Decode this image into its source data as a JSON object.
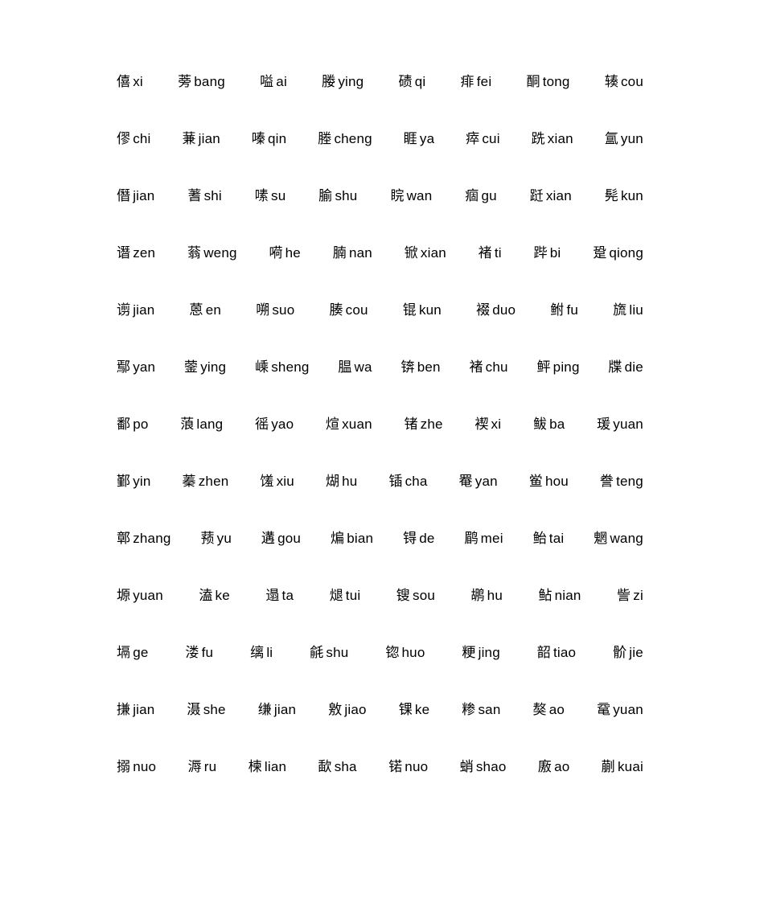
{
  "document": {
    "title": "Chinese Character Pinyin List",
    "text_color": "#000000",
    "background_color": "#ffffff"
  },
  "rows": [
    [
      {
        "hanzi": "僖",
        "pinyin": "xi"
      },
      {
        "hanzi": "蒡",
        "pinyin": "bang"
      },
      {
        "hanzi": "嗌",
        "pinyin": "ai"
      },
      {
        "hanzi": "媵",
        "pinyin": "ying"
      },
      {
        "hanzi": "碛",
        "pinyin": "qi"
      },
      {
        "hanzi": "痱",
        "pinyin": "fei"
      },
      {
        "hanzi": "酮",
        "pinyin": "tong"
      },
      {
        "hanzi": "辏",
        "pinyin": "cou"
      }
    ],
    [
      {
        "hanzi": "僇",
        "pinyin": "chi"
      },
      {
        "hanzi": "蒹",
        "pinyin": "jian"
      },
      {
        "hanzi": "嗪",
        "pinyin": "qin"
      },
      {
        "hanzi": "塍",
        "pinyin": "cheng"
      },
      {
        "hanzi": "睚",
        "pinyin": "ya"
      },
      {
        "hanzi": "瘁",
        "pinyin": "cui"
      },
      {
        "hanzi": "跣",
        "pinyin": "xian"
      },
      {
        "hanzi": "氲",
        "pinyin": "yun"
      }
    ],
    [
      {
        "hanzi": "僭",
        "pinyin": "jian"
      },
      {
        "hanzi": "蓍",
        "pinyin": "shi"
      },
      {
        "hanzi": "嗉",
        "pinyin": "su"
      },
      {
        "hanzi": "腧",
        "pinyin": "shu"
      },
      {
        "hanzi": "睆",
        "pinyin": "wan"
      },
      {
        "hanzi": "痼",
        "pinyin": "gu"
      },
      {
        "hanzi": "跹",
        "pinyin": "xian"
      },
      {
        "hanzi": "髡",
        "pinyin": "kun"
      }
    ],
    [
      {
        "hanzi": "谮",
        "pinyin": "zen"
      },
      {
        "hanzi": "蓊",
        "pinyin": "weng"
      },
      {
        "hanzi": "嗬",
        "pinyin": "he"
      },
      {
        "hanzi": "腩",
        "pinyin": "nan"
      },
      {
        "hanzi": "锨",
        "pinyin": "xian"
      },
      {
        "hanzi": "褚",
        "pinyin": "ti"
      },
      {
        "hanzi": "跸",
        "pinyin": "bi"
      },
      {
        "hanzi": "跫",
        "pinyin": "qiong"
      }
    ],
    [
      {
        "hanzi": "谫",
        "pinyin": "jian"
      },
      {
        "hanzi": "蒽",
        "pinyin": "en"
      },
      {
        "hanzi": "嗍",
        "pinyin": "suo"
      },
      {
        "hanzi": "腠",
        "pinyin": "cou"
      },
      {
        "hanzi": "锟",
        "pinyin": "kun"
      },
      {
        "hanzi": "裰",
        "pinyin": "duo"
      },
      {
        "hanzi": "鲋",
        "pinyin": "fu"
      },
      {
        "hanzi": "旒",
        "pinyin": "liu"
      }
    ],
    [
      {
        "hanzi": "鄢",
        "pinyin": "yan"
      },
      {
        "hanzi": "蓥",
        "pinyin": "ying"
      },
      {
        "hanzi": "嵊",
        "pinyin": "sheng"
      },
      {
        "hanzi": "腽",
        "pinyin": "wa"
      },
      {
        "hanzi": "锛",
        "pinyin": "ben"
      },
      {
        "hanzi": "褚",
        "pinyin": "chu"
      },
      {
        "hanzi": "鲆",
        "pinyin": "ping"
      },
      {
        "hanzi": "牒",
        "pinyin": "die"
      }
    ],
    [
      {
        "hanzi": "鄱",
        "pinyin": "po"
      },
      {
        "hanzi": "蒗",
        "pinyin": "lang"
      },
      {
        "hanzi": "徭",
        "pinyin": "yao"
      },
      {
        "hanzi": "煊",
        "pinyin": "xuan"
      },
      {
        "hanzi": "锗",
        "pinyin": "zhe"
      },
      {
        "hanzi": "褉",
        "pinyin": "xi"
      },
      {
        "hanzi": "鲅",
        "pinyin": "ba"
      },
      {
        "hanzi": "瑗",
        "pinyin": "yuan"
      }
    ],
    [
      {
        "hanzi": "鄞",
        "pinyin": "yin"
      },
      {
        "hanzi": "蓁",
        "pinyin": "zhen"
      },
      {
        "hanzi": "馐",
        "pinyin": "xiu"
      },
      {
        "hanzi": "煳",
        "pinyin": "hu"
      },
      {
        "hanzi": "锸",
        "pinyin": "cha"
      },
      {
        "hanzi": "罨",
        "pinyin": "yan"
      },
      {
        "hanzi": "鲎",
        "pinyin": "hou"
      },
      {
        "hanzi": "誊",
        "pinyin": "teng"
      }
    ],
    [
      {
        "hanzi": "鄣",
        "pinyin": "zhang"
      },
      {
        "hanzi": "蓣",
        "pinyin": "yu"
      },
      {
        "hanzi": "遘",
        "pinyin": "gou"
      },
      {
        "hanzi": "煸",
        "pinyin": "bian"
      },
      {
        "hanzi": "锝",
        "pinyin": "de"
      },
      {
        "hanzi": "鹛",
        "pinyin": "mei"
      },
      {
        "hanzi": "鲐",
        "pinyin": "tai"
      },
      {
        "hanzi": "魍",
        "pinyin": "wang"
      }
    ],
    [
      {
        "hanzi": "塬",
        "pinyin": "yuan"
      },
      {
        "hanzi": "溘",
        "pinyin": "ke"
      },
      {
        "hanzi": "遢",
        "pinyin": "ta"
      },
      {
        "hanzi": "煺",
        "pinyin": "tui"
      },
      {
        "hanzi": "锼",
        "pinyin": "sou"
      },
      {
        "hanzi": "鹕",
        "pinyin": "hu"
      },
      {
        "hanzi": "鲇",
        "pinyin": "nian"
      },
      {
        "hanzi": "訾",
        "pinyin": "zi"
      }
    ],
    [
      {
        "hanzi": "塥",
        "pinyin": "ge"
      },
      {
        "hanzi": "溇",
        "pinyin": "fu"
      },
      {
        "hanzi": "缡",
        "pinyin": "li"
      },
      {
        "hanzi": "毹",
        "pinyin": "shu"
      },
      {
        "hanzi": "锪",
        "pinyin": "huo"
      },
      {
        "hanzi": "粳",
        "pinyin": "jing"
      },
      {
        "hanzi": "韶",
        "pinyin": "tiao"
      },
      {
        "hanzi": "骱",
        "pinyin": "jie"
      }
    ],
    [
      {
        "hanzi": "搛",
        "pinyin": "jian"
      },
      {
        "hanzi": "滠",
        "pinyin": "she"
      },
      {
        "hanzi": "缣",
        "pinyin": "jian"
      },
      {
        "hanzi": "敫",
        "pinyin": "jiao"
      },
      {
        "hanzi": "锞",
        "pinyin": "ke"
      },
      {
        "hanzi": "糁",
        "pinyin": "san"
      },
      {
        "hanzi": "獒",
        "pinyin": "ao"
      },
      {
        "hanzi": "鼋",
        "pinyin": "yuan"
      }
    ],
    [
      {
        "hanzi": "搦",
        "pinyin": "nuo"
      },
      {
        "hanzi": "溽",
        "pinyin": "ru"
      },
      {
        "hanzi": "楝",
        "pinyin": "lian"
      },
      {
        "hanzi": "歃",
        "pinyin": "sha"
      },
      {
        "hanzi": "锘",
        "pinyin": "nuo"
      },
      {
        "hanzi": "蛸",
        "pinyin": "shao"
      },
      {
        "hanzi": "廒",
        "pinyin": "ao"
      },
      {
        "hanzi": "蒯",
        "pinyin": "kuai"
      }
    ]
  ]
}
